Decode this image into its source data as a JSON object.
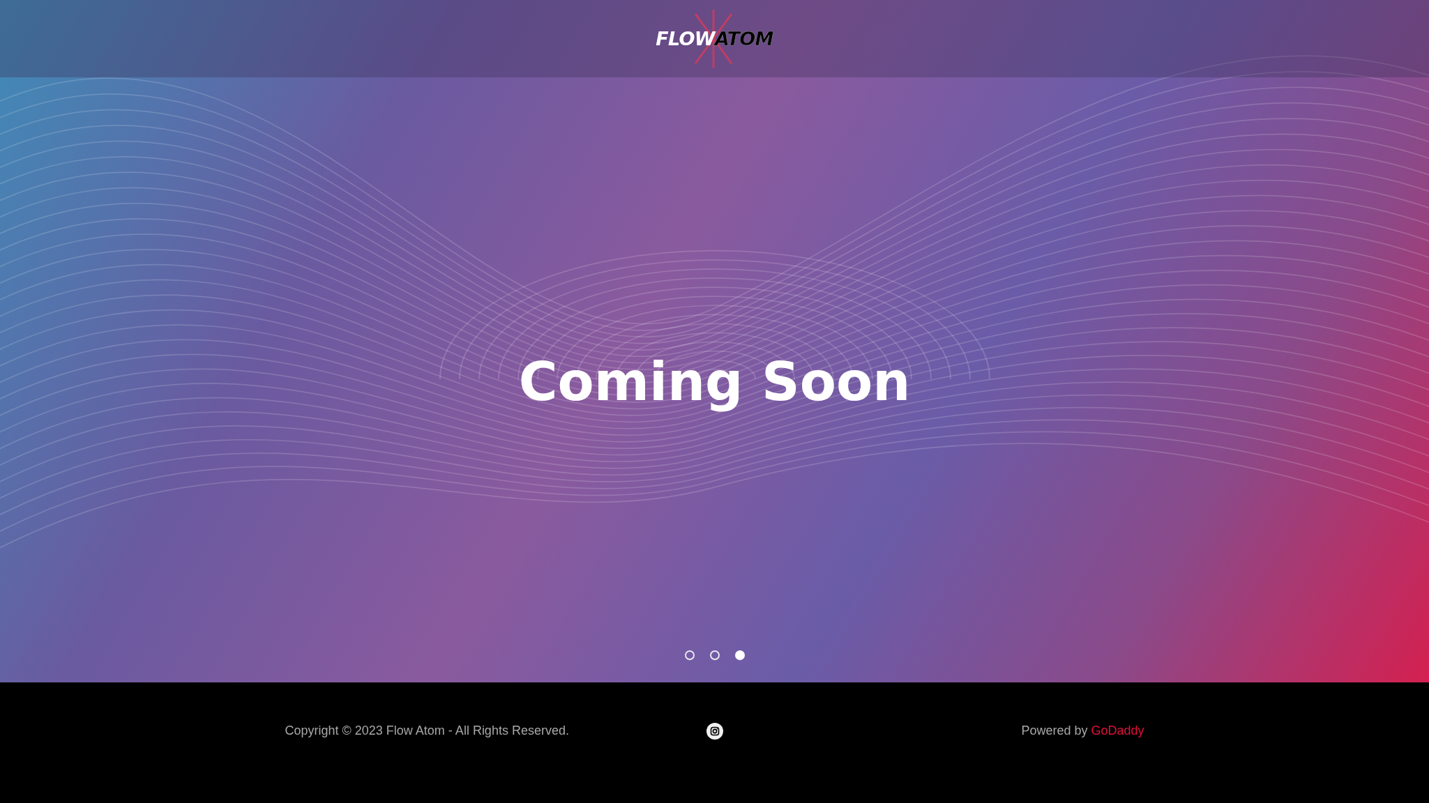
{
  "header": {
    "logo": {
      "part_1": "FLOW",
      "part_2": "ATOM"
    }
  },
  "hero": {
    "heading": "Coming Soon",
    "slides": [
      {
        "selected": false
      },
      {
        "selected": false
      },
      {
        "selected": true
      }
    ]
  },
  "footer": {
    "copyright": "Copyright © 2023 Flow Atom - All Rights Reserved.",
    "powered_by": "Powered by",
    "powered_link": "GoDaddy"
  }
}
